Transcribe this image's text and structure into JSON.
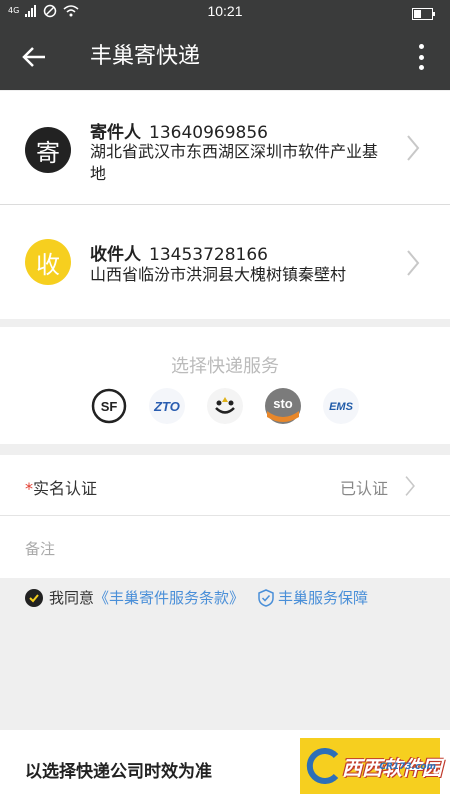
{
  "status": {
    "network": "4G",
    "time": "10:21"
  },
  "appbar": {
    "title": "丰巢寄快递"
  },
  "sender": {
    "badge": "寄",
    "role": "寄件人",
    "phone": "13640969856",
    "address": "湖北省武汉市东西湖区深圳市软件产业基地"
  },
  "receiver": {
    "badge": "收",
    "role": "收件人",
    "phone": "13453728166",
    "address": "山西省临汾市洪洞县大槐树镇秦壁村"
  },
  "services": {
    "title": "选择快递服务",
    "carriers": [
      {
        "name": "SF",
        "icon": "sf-express-logo",
        "color": "#222222"
      },
      {
        "name": "ZTO",
        "icon": "zto-logo",
        "color": "#2a5db0"
      },
      {
        "name": "",
        "icon": "yunda-logo",
        "color": "#222222"
      },
      {
        "name": "sto",
        "icon": "sto-logo",
        "color": "#e8872a"
      },
      {
        "name": "EMS",
        "icon": "ems-logo",
        "color": "#1f5aa8"
      }
    ]
  },
  "form": {
    "required_mark": "*",
    "realname_label": "实名认证",
    "realname_value": "已认证",
    "note_placeholder": "备注"
  },
  "agreement": {
    "prefix": "我同意",
    "terms_link": "《丰巢寄件服务条款》",
    "guarantee_link": "丰巢服务保障"
  },
  "bottom": {
    "text": "以选择快递公司时效为准",
    "watermark": "西西软件园",
    "watermark_sub": "CR173.com"
  },
  "colors": {
    "accent": "#f6cf1f",
    "dark": "#3a3b3b",
    "link": "#4a8fd8"
  }
}
